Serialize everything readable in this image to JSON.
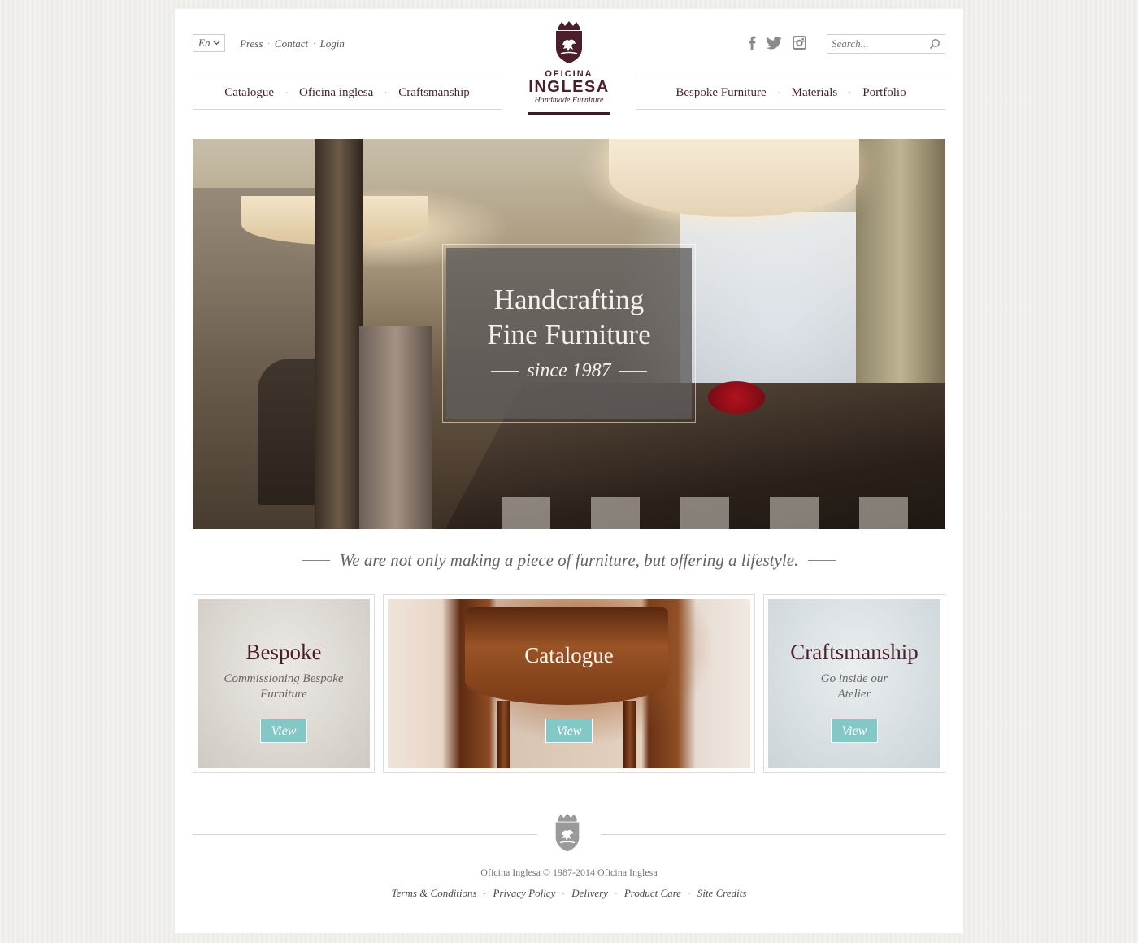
{
  "header": {
    "language": "En",
    "utility_links": [
      "Press",
      "Contact",
      "Login"
    ],
    "search_placeholder": "Search...",
    "social": [
      "facebook-icon",
      "twitter-icon",
      "instagram-icon"
    ]
  },
  "logo": {
    "line1": "OFICINA",
    "line2": "INGLESA",
    "line3": "Handmade Furniture"
  },
  "nav": {
    "left": [
      "Catalogue",
      "Oficina inglesa",
      "Craftsmanship"
    ],
    "right": [
      "Bespoke Furniture",
      "Materials",
      "Portfolio"
    ]
  },
  "hero": {
    "title_line1": "Handcrafting",
    "title_line2": "Fine Furniture",
    "subtitle": "since 1987"
  },
  "tagline": "We are not only making a piece of  furniture, but offering a lifestyle.",
  "cards": [
    {
      "title": "Bespoke",
      "subtitle_line1": "Commissioning Bespoke",
      "subtitle_line2": "Furniture",
      "button": "View"
    },
    {
      "title": "Catalogue",
      "button": "View"
    },
    {
      "title": "Craftsmanship",
      "subtitle_line1": "Go inside our",
      "subtitle_line2": "Atelier",
      "button": "View"
    }
  ],
  "footer": {
    "copyright": "Oficina Inglesa  © 1987-2014 Oficina Inglesa",
    "links": [
      "Terms & Conditions",
      "Privacy Policy",
      "Delivery",
      "Product Care",
      "Site Credits"
    ]
  },
  "colors": {
    "brand": "#4a1f2a",
    "button": "#83c8c7",
    "background": "#efeeea"
  }
}
